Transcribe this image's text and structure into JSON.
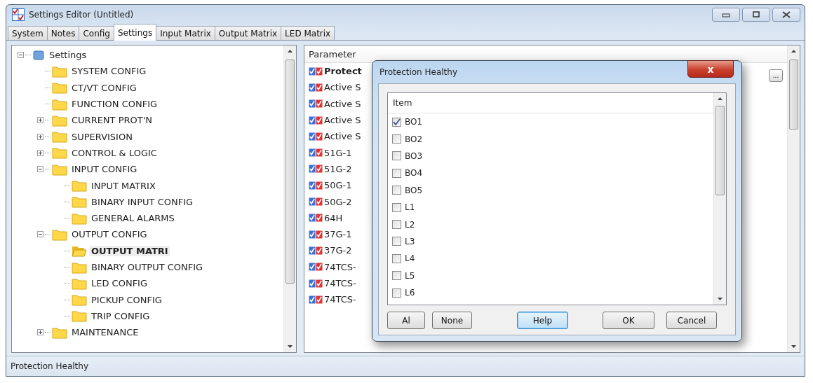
{
  "window": {
    "title": "Settings Editor (Untitled)"
  },
  "tabs": [
    {
      "label": "System",
      "selected": false
    },
    {
      "label": "Notes",
      "selected": false
    },
    {
      "label": "Config",
      "selected": false
    },
    {
      "label": "Settings",
      "selected": true
    },
    {
      "label": "Input Matrix",
      "selected": false
    },
    {
      "label": "Output Matrix",
      "selected": false
    },
    {
      "label": "LED Matrix",
      "selected": false
    }
  ],
  "tree": [
    {
      "label": "Settings",
      "kind": "root",
      "expanded": true,
      "selected": false,
      "children": [
        {
          "label": "SYSTEM CONFIG",
          "selected": false
        },
        {
          "label": "CT/VT CONFIG",
          "selected": false
        },
        {
          "label": "FUNCTION CONFIG",
          "selected": false
        },
        {
          "label": "CURRENT PROT'N",
          "expanded": false,
          "selected": false
        },
        {
          "label": "SUPERVISION",
          "expanded": false,
          "selected": false
        },
        {
          "label": "CONTROL & LOGIC",
          "expanded": false,
          "selected": false
        },
        {
          "label": "INPUT CONFIG",
          "expanded": true,
          "selected": false,
          "children": [
            {
              "label": "INPUT MATRIX",
              "selected": false
            },
            {
              "label": "BINARY INPUT CONFIG",
              "selected": false
            },
            {
              "label": "GENERAL ALARMS",
              "selected": false
            }
          ]
        },
        {
          "label": "OUTPUT CONFIG",
          "expanded": true,
          "selected": false,
          "children": [
            {
              "label": "OUTPUT MATRI",
              "selected": true
            },
            {
              "label": "BINARY OUTPUT CONFIG",
              "selected": false
            },
            {
              "label": "LED CONFIG",
              "selected": false
            },
            {
              "label": "PICKUP CONFIG",
              "selected": false
            },
            {
              "label": "TRIP CONFIG",
              "selected": false
            }
          ]
        },
        {
          "label": "MAINTENANCE",
          "expanded": false,
          "selected": false
        }
      ]
    }
  ],
  "parameters": {
    "column_1": "Parameter",
    "rows": [
      {
        "label": "Protect",
        "selected": true
      },
      {
        "label": "Active S",
        "selected": false
      },
      {
        "label": "Active S",
        "selected": false
      },
      {
        "label": "Active S",
        "selected": false
      },
      {
        "label": "Active S",
        "selected": false
      },
      {
        "label": "51G-1",
        "selected": false
      },
      {
        "label": "51G-2",
        "selected": false
      },
      {
        "label": "50G-1",
        "selected": false
      },
      {
        "label": "50G-2",
        "selected": false
      },
      {
        "label": "64H",
        "selected": false
      },
      {
        "label": "37G-1",
        "selected": false
      },
      {
        "label": "37G-2",
        "selected": false
      },
      {
        "label": "74TCS-",
        "selected": false
      },
      {
        "label": "74TCS-",
        "selected": false
      },
      {
        "label": "74TCS-",
        "selected": false
      }
    ],
    "edit_button": "..."
  },
  "dialog": {
    "title": "Protection Healthy",
    "close": "x",
    "column": "Item",
    "items": [
      {
        "label": "BO1",
        "checked": true
      },
      {
        "label": "BO2",
        "checked": false
      },
      {
        "label": "BO3",
        "checked": false
      },
      {
        "label": "BO4",
        "checked": false
      },
      {
        "label": "BO5",
        "checked": false
      },
      {
        "label": "L1",
        "checked": false
      },
      {
        "label": "L2",
        "checked": false
      },
      {
        "label": "L3",
        "checked": false
      },
      {
        "label": "L4",
        "checked": false
      },
      {
        "label": "L5",
        "checked": false
      },
      {
        "label": "L6",
        "checked": false
      }
    ],
    "buttons": [
      {
        "label": "Al",
        "focused": false
      },
      {
        "label": "None",
        "focused": false
      },
      {
        "label": "Help",
        "focused": true
      },
      {
        "label": "OK",
        "focused": false
      },
      {
        "label": "Cancel",
        "focused": false
      }
    ]
  },
  "status_bar": {
    "text": "Protection Healthy"
  }
}
